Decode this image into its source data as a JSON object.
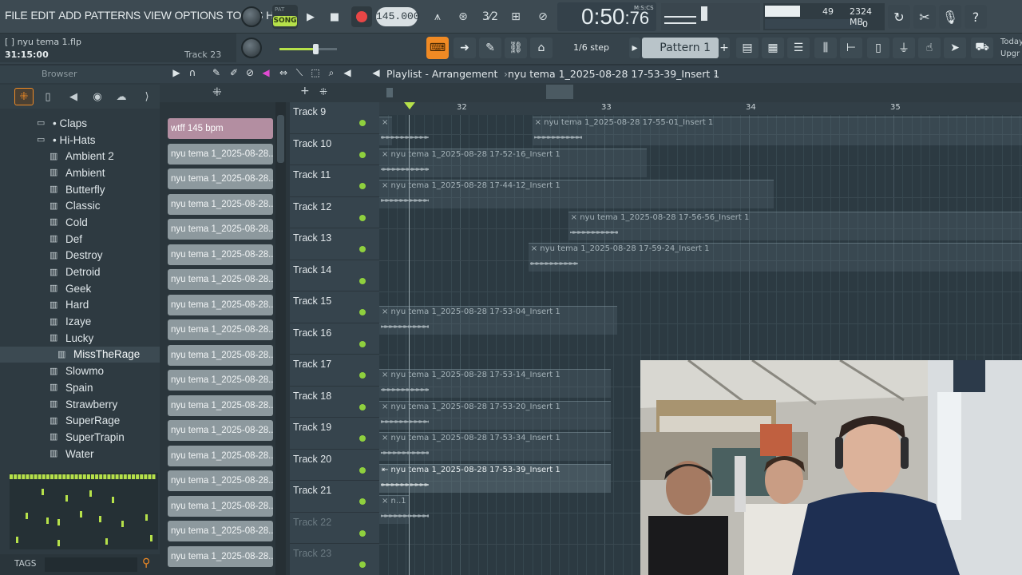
{
  "menu": [
    "FILE",
    "EDIT",
    "ADD",
    "PATTERNS",
    "VIEW",
    "OPTIONS",
    "TOOLS",
    "HELP"
  ],
  "mode": {
    "pat_label": "PAT",
    "song_label": "SONG"
  },
  "tempo": "145.000",
  "time": {
    "main": "0:50",
    "sub": "76",
    "unit": "M:S:CS"
  },
  "cpu": {
    "value": "49",
    "memory": "2324 MB",
    "poly": "0"
  },
  "file": {
    "name": "[ ] nyu tema 1.flp",
    "timestamp": "31:15:00",
    "track": "Track 23"
  },
  "step": "1/6 step",
  "pattern": "Pattern 1",
  "today": [
    "Today",
    "Upgr"
  ],
  "browser": {
    "title": "Browser",
    "items": [
      {
        "label": "• Claps",
        "type": "folder"
      },
      {
        "label": "• Hi-Hats",
        "type": "folder"
      },
      {
        "label": "Ambient 2",
        "type": "file"
      },
      {
        "label": "Ambient",
        "type": "file"
      },
      {
        "label": "Butterfly",
        "type": "file"
      },
      {
        "label": "Classic",
        "type": "file"
      },
      {
        "label": "Cold",
        "type": "file"
      },
      {
        "label": "Def",
        "type": "file"
      },
      {
        "label": "Destroy",
        "type": "file"
      },
      {
        "label": "Detroid",
        "type": "file"
      },
      {
        "label": "Geek",
        "type": "file"
      },
      {
        "label": "Hard",
        "type": "file"
      },
      {
        "label": "Izaye",
        "type": "file"
      },
      {
        "label": "Lucky",
        "type": "file"
      },
      {
        "label": "MissTheRage",
        "type": "sub"
      },
      {
        "label": "Slowmo",
        "type": "file"
      },
      {
        "label": "Spain",
        "type": "file"
      },
      {
        "label": "Strawberry",
        "type": "file"
      },
      {
        "label": "SuperRage",
        "type": "file"
      },
      {
        "label": "SuperTrapin",
        "type": "file"
      },
      {
        "label": "Water",
        "type": "file"
      }
    ],
    "tags_label": "TAGS"
  },
  "playlist": {
    "title": "Playlist - Arrangement",
    "breadcrumb": "nyu tema 1_2025-08-28 17-53-39_Insert 1",
    "ruler": [
      "32",
      "33",
      "34",
      "35"
    ],
    "patterns": [
      "wtff 145 bpm",
      "nyu tema 1_2025-08-28...",
      "nyu tema 1_2025-08-28...",
      "nyu tema 1_2025-08-28...",
      "nyu tema 1_2025-08-28...",
      "nyu tema 1_2025-08-28...",
      "nyu tema 1_2025-08-28...",
      "nyu tema 1_2025-08-28...",
      "nyu tema 1_2025-08-28...",
      "nyu tema 1_2025-08-28...",
      "nyu tema 1_2025-08-28...",
      "nyu tema 1_2025-08-28...",
      "nyu tema 1_2025-08-28...",
      "nyu tema 1_2025-08-28...",
      "nyu tema 1_2025-08-28...",
      "nyu tema 1_2025-08-28...",
      "nyu tema 1_2025-08-28...",
      "nyu tema 1_2025-08-28..."
    ],
    "tracks": [
      "Track 9",
      "Track 10",
      "Track 11",
      "Track 12",
      "Track 13",
      "Track 14",
      "Track 15",
      "Track 16",
      "Track 17",
      "Track 18",
      "Track 19",
      "Track 20",
      "Track 21",
      "Track 22",
      "Track 23"
    ],
    "clips": [
      {
        "row": 0,
        "label": "×",
        "start": 0,
        "end": 0.02
      },
      {
        "row": 0,
        "label": "× nyu tema 1_2025-08-28 17-55-01_Insert 1",
        "start": 0.238,
        "end": 1.0
      },
      {
        "row": 1,
        "label": "× nyu tema 1_2025-08-28 17-52-16_Insert 1",
        "start": 0,
        "end": 0.416
      },
      {
        "row": 2,
        "label": "× nyu tema 1_2025-08-28 17-44-12_Insert 1",
        "start": 0,
        "end": 0.614
      },
      {
        "row": 3,
        "label": "× nyu tema 1_2025-08-28 17-56-56_Insert 1",
        "start": 0.294,
        "end": 1.0
      },
      {
        "row": 4,
        "label": "× nyu tema 1_2025-08-28 17-59-24_Insert 1",
        "start": 0.232,
        "end": 1.0
      },
      {
        "row": 6,
        "label": "× nyu tema 1_2025-08-28 17-53-04_Insert 1",
        "start": 0,
        "end": 0.37
      },
      {
        "row": 8,
        "label": "× nyu tema 1_2025-08-28 17-53-14_Insert 1",
        "start": 0,
        "end": 0.36
      },
      {
        "row": 9,
        "label": "× nyu tema 1_2025-08-28 17-53-20_Insert 1",
        "start": 0,
        "end": 0.36
      },
      {
        "row": 10,
        "label": "× nyu tema 1_2025-08-28 17-53-34_Insert 1",
        "start": 0,
        "end": 0.36
      },
      {
        "row": 11,
        "label": "⇤ nyu tema 1_2025-08-28 17-53-39_Insert 1",
        "start": 0,
        "end": 0.36,
        "selected": true
      },
      {
        "row": 12,
        "label": "× n..1",
        "start": 0,
        "end": 0.046
      }
    ]
  },
  "colors": {
    "accent": "#f08a24",
    "song": "#b6e14a",
    "record": "#e84646",
    "pattern_first": "#b38ea1"
  }
}
